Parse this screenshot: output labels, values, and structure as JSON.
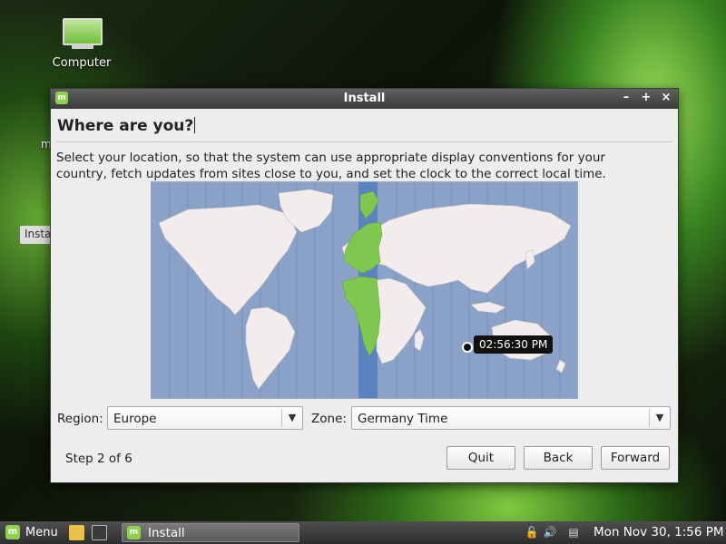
{
  "desktop": {
    "computer_label": "Computer",
    "fragment_m": "m",
    "fragment_install": "Insta"
  },
  "window": {
    "title": "Install",
    "controls": {
      "minimize": "–",
      "maximize": "+",
      "close": "×"
    }
  },
  "page": {
    "heading": "Where are you?",
    "description_line1": "Select your location, so that the system can use appropriate display conventions for your",
    "description_line2": "country, fetch updates from sites close to you, and set the clock to the correct local time."
  },
  "map": {
    "selected_time": "02:56:30 PM",
    "colors": {
      "ocean": "#8ba2c8",
      "land": "#f2ecec",
      "selected_zone": "#7fc850",
      "timezone_band": "#4f7fc0"
    }
  },
  "location": {
    "region_label": "Region:",
    "region_value": "Europe",
    "zone_label": "Zone:",
    "zone_value": "Germany Time"
  },
  "footer": {
    "step": "Step 2 of 6",
    "quit": "Quit",
    "back": "Back",
    "forward": "Forward"
  },
  "taskbar": {
    "menu_label": "Menu",
    "task_label": "Install",
    "clock": "Mon Nov 30,  1:56 PM"
  }
}
